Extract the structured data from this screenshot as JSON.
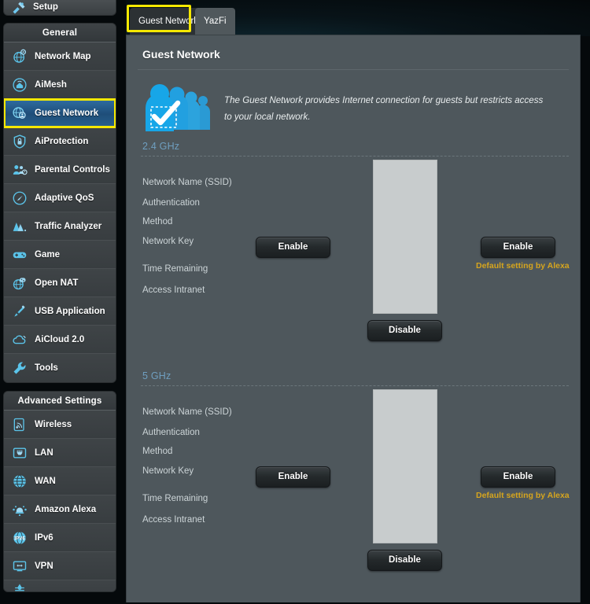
{
  "sidebar": {
    "setup": {
      "label": "Setup",
      "icon": "setup-wizard-icon"
    },
    "groups": [
      {
        "title": "General",
        "items": [
          {
            "label": "Network Map",
            "icon": "network-map-icon",
            "active": false
          },
          {
            "label": "AiMesh",
            "icon": "aimesh-icon",
            "active": false
          },
          {
            "label": "Guest Network",
            "icon": "guest-network-icon",
            "active": true
          },
          {
            "label": "AiProtection",
            "icon": "shield-lock-icon",
            "active": false
          },
          {
            "label": "Parental Controls",
            "icon": "parental-controls-icon",
            "active": false
          },
          {
            "label": "Adaptive QoS",
            "icon": "gauge-icon",
            "active": false
          },
          {
            "label": "Traffic Analyzer",
            "icon": "traffic-analyzer-icon",
            "active": false
          },
          {
            "label": "Game",
            "icon": "gamepad-icon",
            "active": false
          },
          {
            "label": "Open NAT",
            "icon": "open-nat-icon",
            "active": false
          },
          {
            "label": "USB Application",
            "icon": "usb-application-icon",
            "active": false
          },
          {
            "label": "AiCloud 2.0",
            "icon": "cloud-icon",
            "active": false
          },
          {
            "label": "Tools",
            "icon": "wrench-icon",
            "active": false
          }
        ]
      },
      {
        "title": "Advanced Settings",
        "items": [
          {
            "label": "Wireless",
            "icon": "wireless-icon",
            "active": false
          },
          {
            "label": "LAN",
            "icon": "lan-port-icon",
            "active": false
          },
          {
            "label": "WAN",
            "icon": "globe-icon",
            "active": false
          },
          {
            "label": "Amazon Alexa",
            "icon": "amazon-alexa-icon",
            "active": false
          },
          {
            "label": "IPv6",
            "icon": "ipv6-icon",
            "active": false
          },
          {
            "label": "VPN",
            "icon": "vpn-icon",
            "active": false
          }
        ]
      }
    ]
  },
  "tabs": [
    {
      "label": "Guest Network",
      "active": true,
      "highlighted": true
    },
    {
      "label": "YazFi",
      "active": false,
      "highlighted": false
    }
  ],
  "page": {
    "title": "Guest Network",
    "description": "The Guest Network provides Internet connection for guests but restricts access to your local network.",
    "intro_icon": "guest-people-check-icon"
  },
  "bands": [
    {
      "heading": "2.4 GHz",
      "labels": [
        "Network Name (SSID)",
        "Authentication",
        "Method",
        "Network Key",
        "Time Remaining",
        "Access Intranet"
      ],
      "enable_center_label": "Enable",
      "enable_right_label": "Enable",
      "disable_label": "Disable",
      "alexa_note": "Default setting by Alexa"
    },
    {
      "heading": "5 GHz",
      "labels": [
        "Network Name (SSID)",
        "Authentication",
        "Method",
        "Network Key",
        "Time Remaining",
        "Access Intranet"
      ],
      "enable_center_label": "Enable",
      "enable_right_label": "Enable",
      "disable_label": "Disable",
      "alexa_note": "Default setting by Alexa"
    }
  ],
  "colors": {
    "panel_bg": "#4e575c",
    "sidebar_item_bg": "#3f4447",
    "active_item_blue": "#1f4e79",
    "highlight_yellow": "#f5e800",
    "band_heading_blue": "#6f9fc0",
    "alexa_gold": "#d6a51e",
    "placeholder_gray": "#c8cccd",
    "button_dark": "#24292b"
  }
}
